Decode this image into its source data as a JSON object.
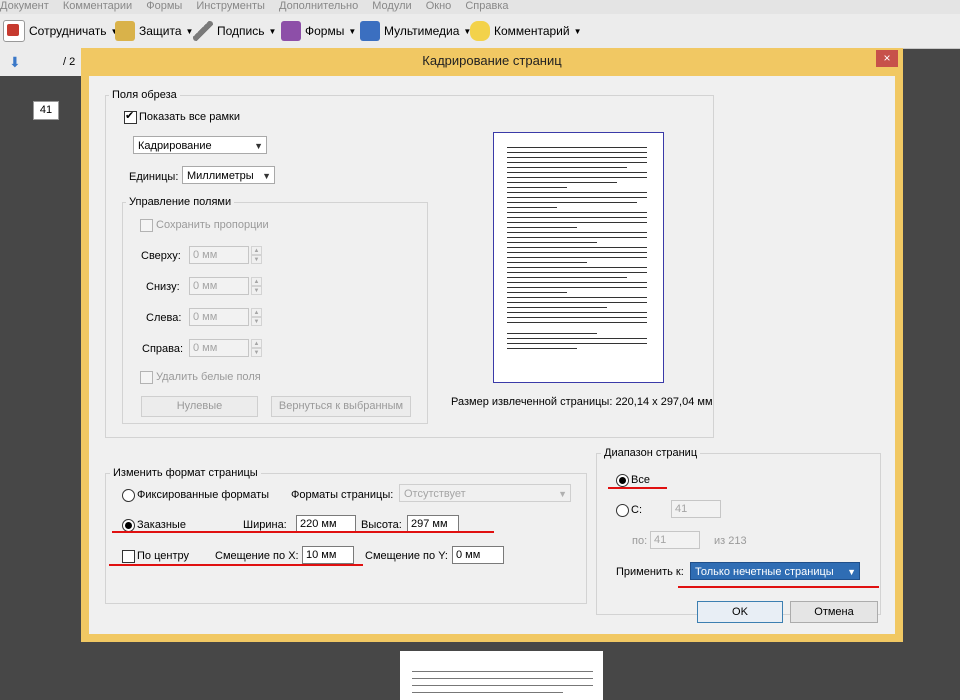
{
  "app": {
    "menu": [
      "Документ",
      "Комментарии",
      "Формы",
      "Инструменты",
      "Дополнительно",
      "Модули",
      "Окно",
      "Справка"
    ],
    "toolbar": {
      "collaborate": "Сотрудничать",
      "protect": "Защита",
      "sign": "Подпись",
      "forms": "Формы",
      "multimedia": "Мультимедиа",
      "comment": "Комментарий"
    },
    "page_number": "41",
    "page_total_partial": "/ 2"
  },
  "dialog": {
    "title": "Кадрирование страниц",
    "close_label": "×",
    "crop_margins": {
      "legend": "Поля обреза",
      "show_all_boxes_label": "Показать все рамки",
      "show_all_boxes_checked": true,
      "box_type_value": "Кадрирование",
      "units_label": "Единицы:",
      "units_value": "Миллиметры",
      "margin_controls": {
        "legend": "Управление полями",
        "keep_proportions_label": "Сохранить пропорции",
        "top_label": "Сверху:",
        "top_value": "0 мм",
        "bottom_label": "Снизу:",
        "bottom_value": "0 мм",
        "left_label": "Слева:",
        "left_value": "0 мм",
        "right_label": "Справа:",
        "right_value": "0 мм",
        "remove_white_label": "Удалить белые поля",
        "zero_button": "Нулевые",
        "revert_button": "Вернуться к выбранным"
      },
      "cropped_size_text": "Размер извлеченной страницы: 220,14 x 297,04 мм"
    },
    "page_size": {
      "legend": "Изменить формат страницы",
      "fixed_label": "Фиксированные форматы",
      "formats_label": "Форматы страницы:",
      "formats_value": "Отсутствует",
      "custom_label": "Заказные",
      "custom_selected": true,
      "width_label": "Ширина:",
      "width_value": "220 мм",
      "height_label": "Высота:",
      "height_value": "297 мм",
      "center_label": "По центру",
      "center_checked": false,
      "offset_x_label": "Смещение по X:",
      "offset_x_value": "10 мм",
      "offset_y_label": "Смещение по Y:",
      "offset_y_value": "0 мм"
    },
    "page_range": {
      "legend": "Диапазон страниц",
      "all_label": "Все",
      "all_selected": true,
      "from_label": "С:",
      "from_value": "41",
      "to_label": "по:",
      "to_value": "41",
      "of_text": "из 213",
      "apply_to_label": "Применить к:",
      "apply_to_value": "Только нечетные страницы"
    },
    "ok_button": "OK",
    "cancel_button": "Отмена"
  },
  "colors": {
    "dialog_frame": "#f1c863",
    "annotation_underline": "#e01010",
    "selection_blue": "#2f6db4"
  }
}
